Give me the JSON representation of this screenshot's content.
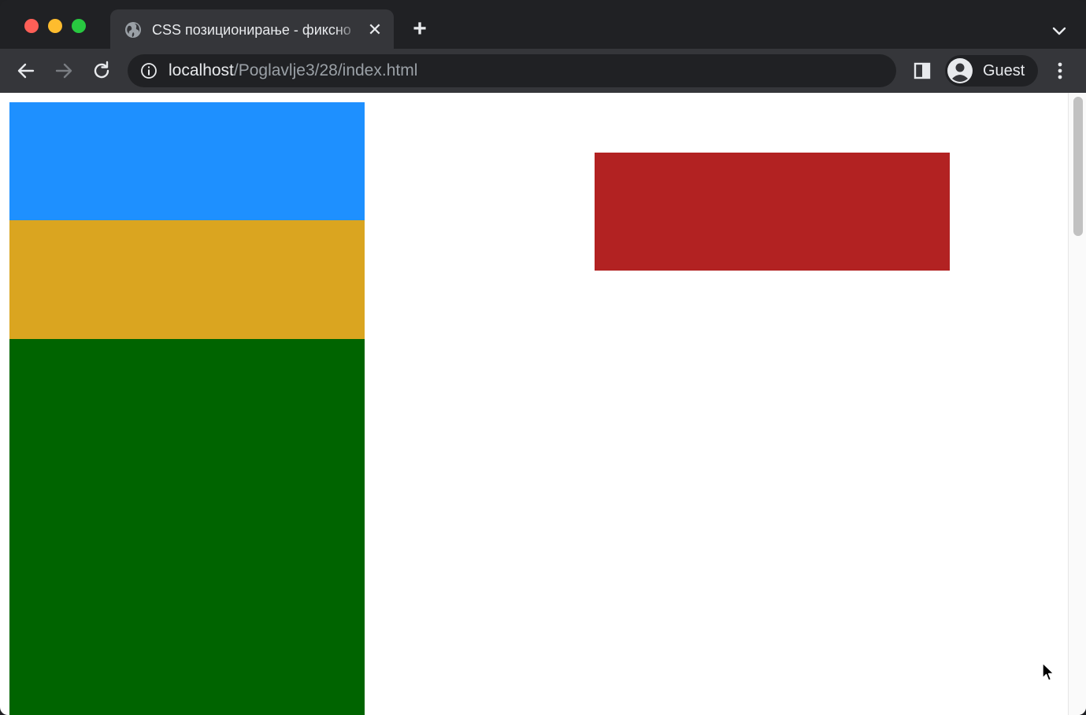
{
  "window": {
    "controls": [
      "close",
      "minimize",
      "maximize"
    ]
  },
  "tab": {
    "title": "CSS позиционирање - фиксно",
    "favicon": "globe-icon",
    "close_icon": "close-icon"
  },
  "tabstrip": {
    "new_tab_icon": "plus-icon",
    "tab_search_icon": "chevron-down-icon"
  },
  "toolbar": {
    "back_icon": "arrow-left-icon",
    "forward_icon": "arrow-right-icon",
    "reload_icon": "reload-icon",
    "site_info_icon": "info-icon",
    "url_host": "localhost",
    "url_path": "/Poglavlje3/28/index.html",
    "side_panel_icon": "side-panel-icon",
    "profile_label": "Guest",
    "profile_icon": "person-icon",
    "menu_icon": "kebab-menu-icon"
  },
  "page": {
    "background": "#ffffff",
    "boxes": [
      {
        "name": "blue-box",
        "color": "#1e90ff"
      },
      {
        "name": "gold-box",
        "color": "#daa520"
      },
      {
        "name": "green-box",
        "color": "#006400"
      },
      {
        "name": "red-box",
        "color": "#b22222"
      }
    ]
  },
  "colors": {
    "chrome_dark": "#202124",
    "chrome_toolbar": "#35363a",
    "text_primary": "#e8eaed",
    "text_secondary": "#9aa0a6"
  }
}
